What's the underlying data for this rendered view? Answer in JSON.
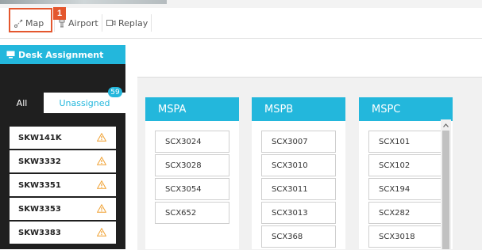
{
  "toolbar": {
    "map_label": "Map",
    "airport_label": "Airport",
    "replay_label": "Replay",
    "step_badge": "1"
  },
  "sidebar": {
    "title": "Desk Assignment",
    "tabs": {
      "all": "All",
      "unassigned": "Unassigned",
      "unassigned_count": "59"
    },
    "flights": [
      "SKW141K",
      "SKW3332",
      "SKW3351",
      "SKW3353",
      "SKW3383"
    ]
  },
  "desks": [
    {
      "name": "MSPA",
      "flights": [
        "SCX3024",
        "SCX3028",
        "SCX3054",
        "SCX652"
      ]
    },
    {
      "name": "MSPB",
      "flights": [
        "SCX3007",
        "SCX3010",
        "SCX3011",
        "SCX3013",
        "SCX368"
      ]
    },
    {
      "name": "MSPC",
      "flights": [
        "SCX101",
        "SCX102",
        "SCX194",
        "SCX282",
        "SCX3018"
      ]
    }
  ],
  "colors": {
    "accent": "#23b7dc",
    "highlight": "#e4572e",
    "warning": "#f0a030",
    "sidebar_bg": "#1f1f1f"
  },
  "icons": {
    "map": "route-icon",
    "airport": "tower-icon",
    "replay": "video-icon",
    "header": "monitor-icon",
    "flight": "warning-icon"
  }
}
